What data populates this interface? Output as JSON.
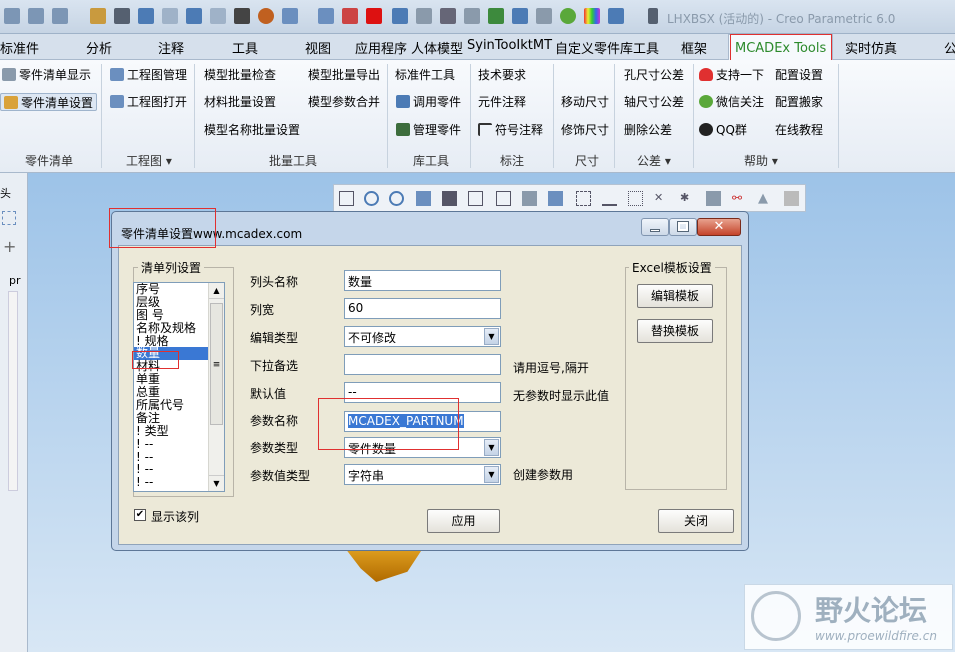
{
  "app": {
    "title": "LHXBSX (活动的) - Creo Parametric 6.0"
  },
  "tabs": [
    {
      "label": "标准件"
    },
    {
      "label": "分析"
    },
    {
      "label": "注释"
    },
    {
      "label": "工具"
    },
    {
      "label": "视图"
    },
    {
      "label": "应用程序"
    },
    {
      "label": "人体模型"
    },
    {
      "label": "SyinTooIktMT"
    },
    {
      "label": "自定义零件库工具"
    },
    {
      "label": "框架"
    },
    {
      "label": "MCADEx Tools"
    },
    {
      "label": "实时仿真"
    },
    {
      "label": "公"
    }
  ],
  "ribbon": {
    "parts": {
      "show": "零件清单显示",
      "setup": "零件清单设置",
      "group": "零件清单"
    },
    "drawing": {
      "manage": "工程图管理",
      "open": "工程图打开",
      "group": "工程图"
    },
    "batch": {
      "check": "模型批量检查",
      "export": "模型批量导出",
      "material": "材料批量设置",
      "merge": "模型参数合并",
      "name": "模型名称批量设置",
      "group": "批量工具"
    },
    "lib": {
      "std": "标准件工具",
      "call": "调用零件",
      "manage": "管理零件",
      "group": "库工具"
    },
    "note": {
      "req": "技术要求",
      "elem": "元件注释",
      "sym": "符号注释",
      "group": "标注"
    },
    "dim": {
      "move": "移动尺寸",
      "modify": "修饰尺寸",
      "group": "尺寸"
    },
    "tol": {
      "hole": "孔尺寸公差",
      "shaft": "轴尺寸公差",
      "del": "删除公差",
      "group": "公差"
    },
    "help": {
      "support": "支持一下",
      "config": "配置设置",
      "wechat": "微信关注",
      "move": "配置搬家",
      "qq": "QQ群",
      "tutorial": "在线教程",
      "group": "帮助"
    }
  },
  "left_panel": {
    "tab": "pr"
  },
  "dialog": {
    "title": "零件清单设置www.mcadex.com",
    "list_group": "清单列设置",
    "list_items": [
      "序号",
      "层级",
      "图 号",
      "名称及规格",
      "! 规格",
      "数量",
      "材料",
      "单重",
      "总重",
      "所属代号",
      "备注",
      "! 类型",
      "! --",
      "! --",
      "! --",
      "! --"
    ],
    "selected_index": 5,
    "fields": {
      "col_name": {
        "label": "列头名称",
        "value": "数量"
      },
      "col_width": {
        "label": "列宽",
        "value": "60"
      },
      "edit_type": {
        "label": "编辑类型",
        "value": "不可修改"
      },
      "dropdown": {
        "label": "下拉备选",
        "value": "",
        "hint": "请用逗号,隔开"
      },
      "default": {
        "label": "默认值",
        "value": "--",
        "hint": "无参数时显示此值"
      },
      "param_name": {
        "label": "参数名称",
        "value": "MCADEX_PARTNUM"
      },
      "param_type": {
        "label": "参数类型",
        "value": "零件数量"
      },
      "param_value_type": {
        "label": "参数值类型",
        "value": "字符串",
        "hint": "创建参数用"
      }
    },
    "show_column": {
      "label": "显示该列",
      "checked": true
    },
    "apply": "应用",
    "excel_group": "Excel模板设置",
    "edit_template": "编辑模板",
    "replace_template": "替换模板",
    "close": "关闭"
  },
  "watermark": {
    "title": "野火论坛",
    "url": "www.proewildfire.cn"
  },
  "colors": {
    "accent_green": "#2c8a2c",
    "highlight_red": "#e03030",
    "selection_blue": "#3a78d4"
  }
}
